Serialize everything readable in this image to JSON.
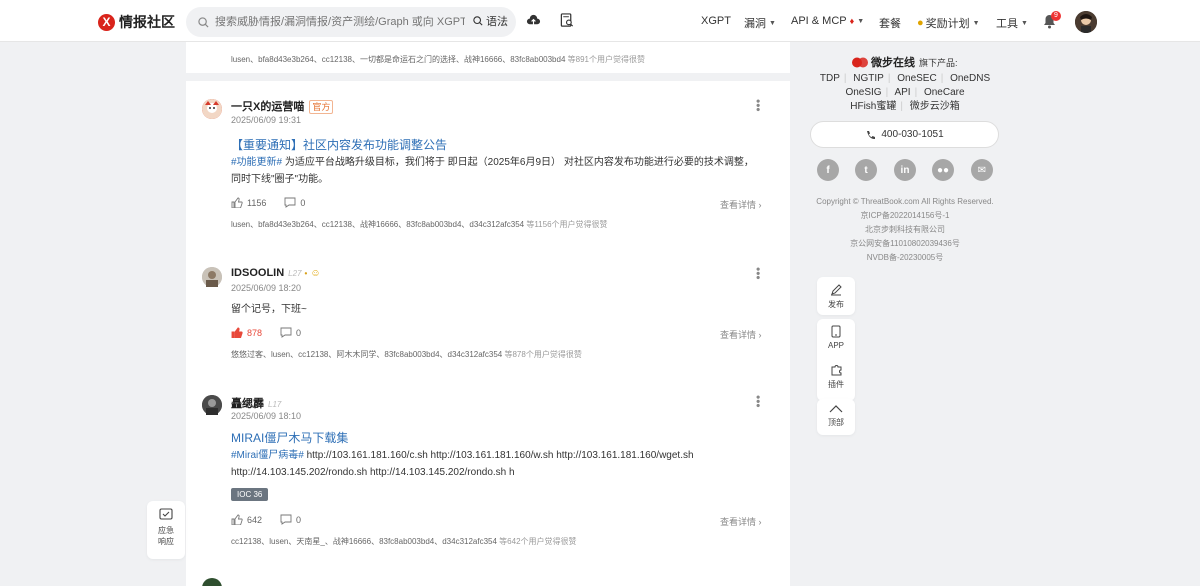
{
  "header": {
    "logo_text": "情报社区",
    "search_placeholder": "搜索威胁情报/漏洞情报/资产测绘/Graph 或向 XGPT提问吧~",
    "search_button": "语法",
    "nav": {
      "xgpt": "XGPT",
      "vuln": "漏洞",
      "api_mcp": "API & MCP",
      "package": "套餐",
      "reward": "奖励计划",
      "tools": "工具"
    },
    "notification_count": "9"
  },
  "feed": {
    "top_likers": {
      "names": "lusen、bfa8d43e3b264、cc12138、一切都是命运石之门的选择、战神16666、83fc8ab003bd4",
      "tail": " 等891个用户觉得很赞"
    },
    "posts": [
      {
        "author": "一只X的运营喵",
        "badge": "官方",
        "time": "2025/06/09 19:31",
        "title": "【重要通知】社区内容发布功能调整公告",
        "tag": "#功能更新#",
        "body": " 为适应平台战略升级目标，我们将于 即日起（2025年6月9日） 对社区内容发布功能进行必要的技术调整，同时下线\"圈子\"功能。",
        "likes": "1156",
        "comments": "0",
        "detail": "查看详情",
        "likers": "lusen、bfa8d43e3b264、cc12138、战神16666、83fc8ab003bd4、d34c312afc354",
        "likers_tail": " 等1156个用户觉得很赞"
      },
      {
        "author": "IDSOOLIN",
        "level": "L27",
        "time": "2025/06/09 18:20",
        "body": "留个记号，下班~",
        "likes": "878",
        "comments": "0",
        "detail": "查看详情",
        "likers": "悠悠过客、lusen、cc12138、阿木木同学、83fc8ab003bd4、d34c312afc354",
        "likers_tail": " 等878个用户觉得很赞"
      },
      {
        "author": "矗缌霹",
        "level": "L17",
        "time": "2025/06/09 18:10",
        "title": "MIRAI僵尸木马下载集",
        "tag": "#Mirai僵尸病毒#",
        "body": " http://103.161.181.160/c.sh http://103.161.181.160/w.sh http://103.161.181.160/wget.sh http://14.103.145.202/rondo.sh http://14.103.145.202/rondo.sh h",
        "ioc": "IOC 36",
        "likes": "642",
        "comments": "0",
        "detail": "查看详情",
        "likers": "cc12138、lusen、天南星_、战神16666、83fc8ab003bd4、d34c312afc354",
        "likers_tail": " 等642个用户觉得很赞"
      }
    ]
  },
  "sidebar": {
    "brand": "微步在线",
    "brand_sub": "旗下产品:",
    "products_line1": [
      "TDP",
      "NGTIP",
      "OneSEC",
      "OneDNS"
    ],
    "products_line2": [
      "OneSIG",
      "API",
      "OneCare"
    ],
    "products_line3": [
      "HFish蜜罐",
      "微步云沙箱"
    ],
    "phone": "400-030-1051",
    "social_icons": [
      "facebook-icon",
      "twitter-icon",
      "linkedin-icon",
      "wechat-icon",
      "email-icon"
    ],
    "legal": [
      "Copyright © ThreatBook.com All Rights Reserved.",
      "京ICP备2022014156号-1",
      "北京步刺科技有限公司",
      "京公网安备11010802039436号",
      "NVDB备-20230005号"
    ]
  },
  "float": {
    "publish": "发布",
    "app": "APP",
    "plugin": "插件",
    "top": "顶部",
    "emergency_1": "应急",
    "emergency_2": "响应"
  },
  "colors": {
    "brand_red": "#d9241b",
    "link_blue": "#2e6fb6",
    "like_red": "#e8493a"
  }
}
